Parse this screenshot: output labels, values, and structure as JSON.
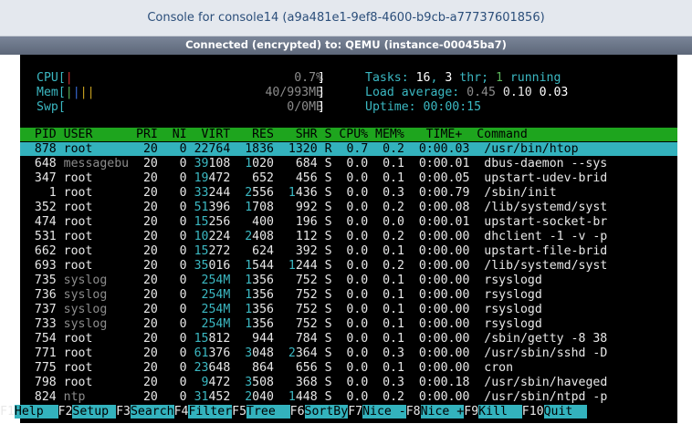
{
  "window": {
    "title": "Console for console14 (a9a481e1-9ef8-4600-b9cb-a77737601856)",
    "status": "Connected (encrypted) to: QEMU (instance-00045ba7)"
  },
  "meters": {
    "cpu_label": "CPU[",
    "cpu_bar": "|",
    "cpu_value": "0.7%",
    "cpu_end": "]",
    "mem_label": "Mem[",
    "mem_bar": "||||",
    "mem_value": "40/993MB",
    "mem_end": "]",
    "swp_label": "Swp[",
    "swp_value": "0/0MB",
    "swp_end": "]"
  },
  "summary": {
    "tasks_label": "Tasks: ",
    "tasks": "16",
    "thr": "3",
    "thr_label": " thr; ",
    "running": "1",
    "running_label": " running",
    "load_label": "Load average: ",
    "load1": "0.45",
    "load5": "0.10",
    "load15": "0.03",
    "uptime_label": "Uptime: ",
    "uptime": "00:00:15"
  },
  "columns": [
    "PID",
    "USER",
    "PRI",
    "NI",
    "VIRT",
    "RES",
    "SHR",
    "S",
    "CPU%",
    "MEM%",
    "TIME+",
    "Command"
  ],
  "column_header_line": "  PID USER      PRI  NI  VIRT   RES   SHR S CPU% MEM%   TIME+  Command",
  "processes": [
    {
      "pid": "878",
      "user": "root",
      "pri": "20",
      "ni": "0",
      "virt": "22764",
      "res": "1836",
      "shr": "1320",
      "s": "R",
      "cpu": "0.7",
      "mem": "0.2",
      "time": "0:00.03",
      "cmd": "/usr/bin/htop"
    },
    {
      "pid": "648",
      "user": "messagebu",
      "pri": "20",
      "ni": "0",
      "virt": "39108",
      "res": "1020",
      "shr": "684",
      "s": "S",
      "cpu": "0.0",
      "mem": "0.1",
      "time": "0:00.01",
      "cmd": "dbus-daemon --sys"
    },
    {
      "pid": "347",
      "user": "root",
      "pri": "20",
      "ni": "0",
      "virt": "19472",
      "res": "652",
      "shr": "456",
      "s": "S",
      "cpu": "0.0",
      "mem": "0.1",
      "time": "0:00.05",
      "cmd": "upstart-udev-brid"
    },
    {
      "pid": "1",
      "user": "root",
      "pri": "20",
      "ni": "0",
      "virt": "33244",
      "res": "2556",
      "shr": "1436",
      "s": "S",
      "cpu": "0.0",
      "mem": "0.3",
      "time": "0:00.79",
      "cmd": "/sbin/init"
    },
    {
      "pid": "352",
      "user": "root",
      "pri": "20",
      "ni": "0",
      "virt": "51396",
      "res": "1708",
      "shr": "992",
      "s": "S",
      "cpu": "0.0",
      "mem": "0.2",
      "time": "0:00.08",
      "cmd": "/lib/systemd/syst"
    },
    {
      "pid": "474",
      "user": "root",
      "pri": "20",
      "ni": "0",
      "virt": "15256",
      "res": "400",
      "shr": "196",
      "s": "S",
      "cpu": "0.0",
      "mem": "0.0",
      "time": "0:00.01",
      "cmd": "upstart-socket-br"
    },
    {
      "pid": "531",
      "user": "root",
      "pri": "20",
      "ni": "0",
      "virt": "10224",
      "res": "2408",
      "shr": "112",
      "s": "S",
      "cpu": "0.0",
      "mem": "0.2",
      "time": "0:00.00",
      "cmd": "dhclient -1 -v -p"
    },
    {
      "pid": "662",
      "user": "root",
      "pri": "20",
      "ni": "0",
      "virt": "15272",
      "res": "624",
      "shr": "392",
      "s": "S",
      "cpu": "0.0",
      "mem": "0.1",
      "time": "0:00.00",
      "cmd": "upstart-file-brid"
    },
    {
      "pid": "693",
      "user": "root",
      "pri": "20",
      "ni": "0",
      "virt": "35016",
      "res": "1544",
      "shr": "1244",
      "s": "S",
      "cpu": "0.0",
      "mem": "0.2",
      "time": "0:00.00",
      "cmd": "/lib/systemd/syst"
    },
    {
      "pid": "735",
      "user": "syslog",
      "pri": "20",
      "ni": "0",
      "virt": "254M",
      "res": "1356",
      "shr": "752",
      "s": "S",
      "cpu": "0.0",
      "mem": "0.1",
      "time": "0:00.00",
      "cmd": "rsyslogd"
    },
    {
      "pid": "736",
      "user": "syslog",
      "pri": "20",
      "ni": "0",
      "virt": "254M",
      "res": "1356",
      "shr": "752",
      "s": "S",
      "cpu": "0.0",
      "mem": "0.1",
      "time": "0:00.00",
      "cmd": "rsyslogd"
    },
    {
      "pid": "737",
      "user": "syslog",
      "pri": "20",
      "ni": "0",
      "virt": "254M",
      "res": "1356",
      "shr": "752",
      "s": "S",
      "cpu": "0.0",
      "mem": "0.1",
      "time": "0:00.00",
      "cmd": "rsyslogd"
    },
    {
      "pid": "733",
      "user": "syslog",
      "pri": "20",
      "ni": "0",
      "virt": "254M",
      "res": "1356",
      "shr": "752",
      "s": "S",
      "cpu": "0.0",
      "mem": "0.1",
      "time": "0:00.00",
      "cmd": "rsyslogd"
    },
    {
      "pid": "754",
      "user": "root",
      "pri": "20",
      "ni": "0",
      "virt": "15812",
      "res": "944",
      "shr": "784",
      "s": "S",
      "cpu": "0.0",
      "mem": "0.1",
      "time": "0:00.00",
      "cmd": "/sbin/getty -8 38"
    },
    {
      "pid": "771",
      "user": "root",
      "pri": "20",
      "ni": "0",
      "virt": "61376",
      "res": "3048",
      "shr": "2364",
      "s": "S",
      "cpu": "0.0",
      "mem": "0.3",
      "time": "0:00.00",
      "cmd": "/usr/sbin/sshd -D"
    },
    {
      "pid": "775",
      "user": "root",
      "pri": "20",
      "ni": "0",
      "virt": "23648",
      "res": "864",
      "shr": "656",
      "s": "S",
      "cpu": "0.0",
      "mem": "0.1",
      "time": "0:00.00",
      "cmd": "cron"
    },
    {
      "pid": "798",
      "user": "root",
      "pri": "20",
      "ni": "0",
      "virt": "9472",
      "res": "3508",
      "shr": "368",
      "s": "S",
      "cpu": "0.0",
      "mem": "0.3",
      "time": "0:00.18",
      "cmd": "/usr/sbin/haveged"
    },
    {
      "pid": "824",
      "user": "ntp",
      "pri": "20",
      "ni": "0",
      "virt": "31452",
      "res": "2040",
      "shr": "1448",
      "s": "S",
      "cpu": "0.0",
      "mem": "0.2",
      "time": "0:00.00",
      "cmd": "/usr/sbin/ntpd -p"
    }
  ],
  "function_keys": [
    {
      "key": "F1",
      "label": "Help  "
    },
    {
      "key": "F2",
      "label": "Setup "
    },
    {
      "key": "F3",
      "label": "Search"
    },
    {
      "key": "F4",
      "label": "Filter"
    },
    {
      "key": "F5",
      "label": "Tree  "
    },
    {
      "key": "F6",
      "label": "SortBy"
    },
    {
      "key": "F7",
      "label": "Nice -"
    },
    {
      "key": "F8",
      "label": "Nice +"
    },
    {
      "key": "F9",
      "label": "Kill  "
    },
    {
      "key": "F10",
      "label": "Quit  "
    }
  ],
  "colors": {
    "terminal_bg": "#000000",
    "header_bar": "#1ea51e",
    "selection_bar": "#33b2bd",
    "title_text": "#2b4e7a"
  }
}
